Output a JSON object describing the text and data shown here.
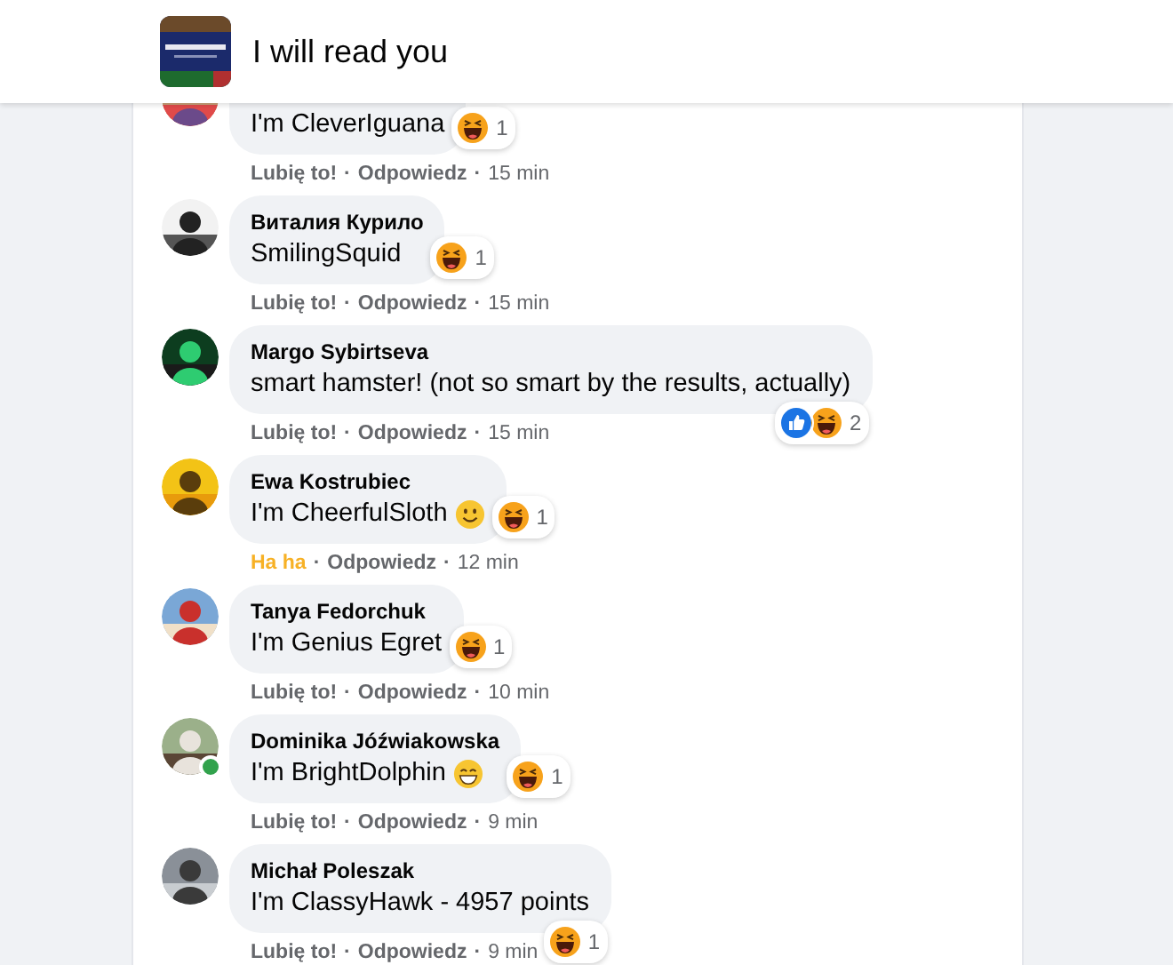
{
  "header": {
    "title": "I will read you"
  },
  "comments": [
    {
      "text": "I'm CleverIguana",
      "reactions": [
        {
          "kind": "haha"
        }
      ],
      "reaction_count": "1",
      "like_action": "Lubię to!",
      "reacted": false,
      "separator": "·",
      "reply": "Odpowiedz",
      "time": "15 min",
      "online": false
    },
    {
      "name": "Виталия Курило",
      "text": "SmilingSquid",
      "reactions": [
        {
          "kind": "haha"
        }
      ],
      "reaction_count": "1",
      "like_action": "Lubię to!",
      "reacted": false,
      "separator": "·",
      "reply": "Odpowiedz",
      "time": "15 min",
      "online": false
    },
    {
      "name": "Margo Sybirtseva",
      "text": "smart hamster! (not so smart by the results, actually)",
      "reactions": [
        {
          "kind": "like"
        },
        {
          "kind": "haha"
        }
      ],
      "reaction_count": "2",
      "like_action": "Lubię to!",
      "reacted": false,
      "separator": "·",
      "reply": "Odpowiedz",
      "time": "15 min",
      "online": false
    },
    {
      "name": "Ewa Kostrubiec",
      "text": "I'm CheerfulSloth",
      "emoji": {
        "kind": "smile"
      },
      "reactions": [
        {
          "kind": "haha"
        }
      ],
      "reaction_count": "1",
      "like_action": "Ha ha",
      "reacted": true,
      "separator": "·",
      "reply": "Odpowiedz",
      "time": "12 min",
      "online": false
    },
    {
      "name": "Tanya Fedorchuk",
      "text": "I'm Genius Egret",
      "reactions": [
        {
          "kind": "haha"
        }
      ],
      "reaction_count": "1",
      "like_action": "Lubię to!",
      "reacted": false,
      "separator": "·",
      "reply": "Odpowiedz",
      "time": "10 min",
      "online": false
    },
    {
      "name": "Dominika Jóźwiakowska",
      "text": "I'm BrightDolphin",
      "emoji": {
        "kind": "grin"
      },
      "reactions": [
        {
          "kind": "haha"
        }
      ],
      "reaction_count": "1",
      "like_action": "Lubię to!",
      "reacted": false,
      "separator": "·",
      "reply": "Odpowiedz",
      "time": "9 min",
      "online": true
    },
    {
      "name": "Michał Poleszak",
      "text": "I'm ClassyHawk - 4957 points",
      "reactions": [
        {
          "kind": "haha"
        }
      ],
      "reaction_count": "1",
      "like_action": "Lubię to!",
      "reacted": false,
      "separator": "·",
      "reply": "Odpowiedz",
      "time": "9 min",
      "online": false
    }
  ]
}
